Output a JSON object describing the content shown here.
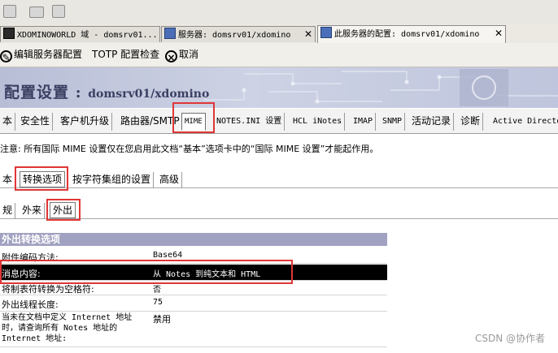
{
  "window_tabs": [
    {
      "label": "XDOMINOWORLD 域 - domsrv01..."
    },
    {
      "label": "服务器:  domsrv01/xdomino"
    },
    {
      "label": "此服务器的配置:  domsrv01/xdomino"
    }
  ],
  "close_glyph": "✕",
  "actions": {
    "edit": "编辑服务器配置",
    "totp": "TOTP 配置检查",
    "cancel": "取消"
  },
  "banner": {
    "title": "配置设置 :",
    "server": "domsrv01/xdomino"
  },
  "main_tabs": [
    "本",
    "安全性",
    "客户机升级",
    "路由器/SMTP",
    "MIME",
    "NOTES.INI 设置",
    "HCL iNotes",
    "IMAP",
    "SNMP",
    "活动记录",
    "诊断",
    "Active Directo"
  ],
  "note": "注意: 所有国际 MIME 设置仅在您启用此文档“基本”选项卡中的“国际 MIME 设置”才能起作用。",
  "sub_tabs": [
    "本",
    "转换选项",
    "按字符集组的设置",
    "高级"
  ],
  "sub_sub_tabs": [
    "规",
    "外来",
    "外出"
  ],
  "section_title": "外出转换选项",
  "rows": [
    {
      "label": "附件编码方法:",
      "value": "Base64"
    },
    {
      "label": "消息内容:",
      "value": "从 Notes 到纯文本和 HTML"
    },
    {
      "label": "将制表符转换为空格符:",
      "value": "否"
    },
    {
      "label": "外出线程长度:",
      "value": "75"
    },
    {
      "label_lines": [
        "当未在文档中定义 Internet 地址",
        "时，请查询所有 Notes 地址的",
        "Internet 地址:"
      ],
      "value": "禁用"
    }
  ],
  "watermark": "CSDN @协作者",
  "colors": {
    "highlight_box": "#e03636",
    "section_header": "#a1a1c1",
    "banner_text": "#3b3f62",
    "selected_row": "#000000"
  }
}
